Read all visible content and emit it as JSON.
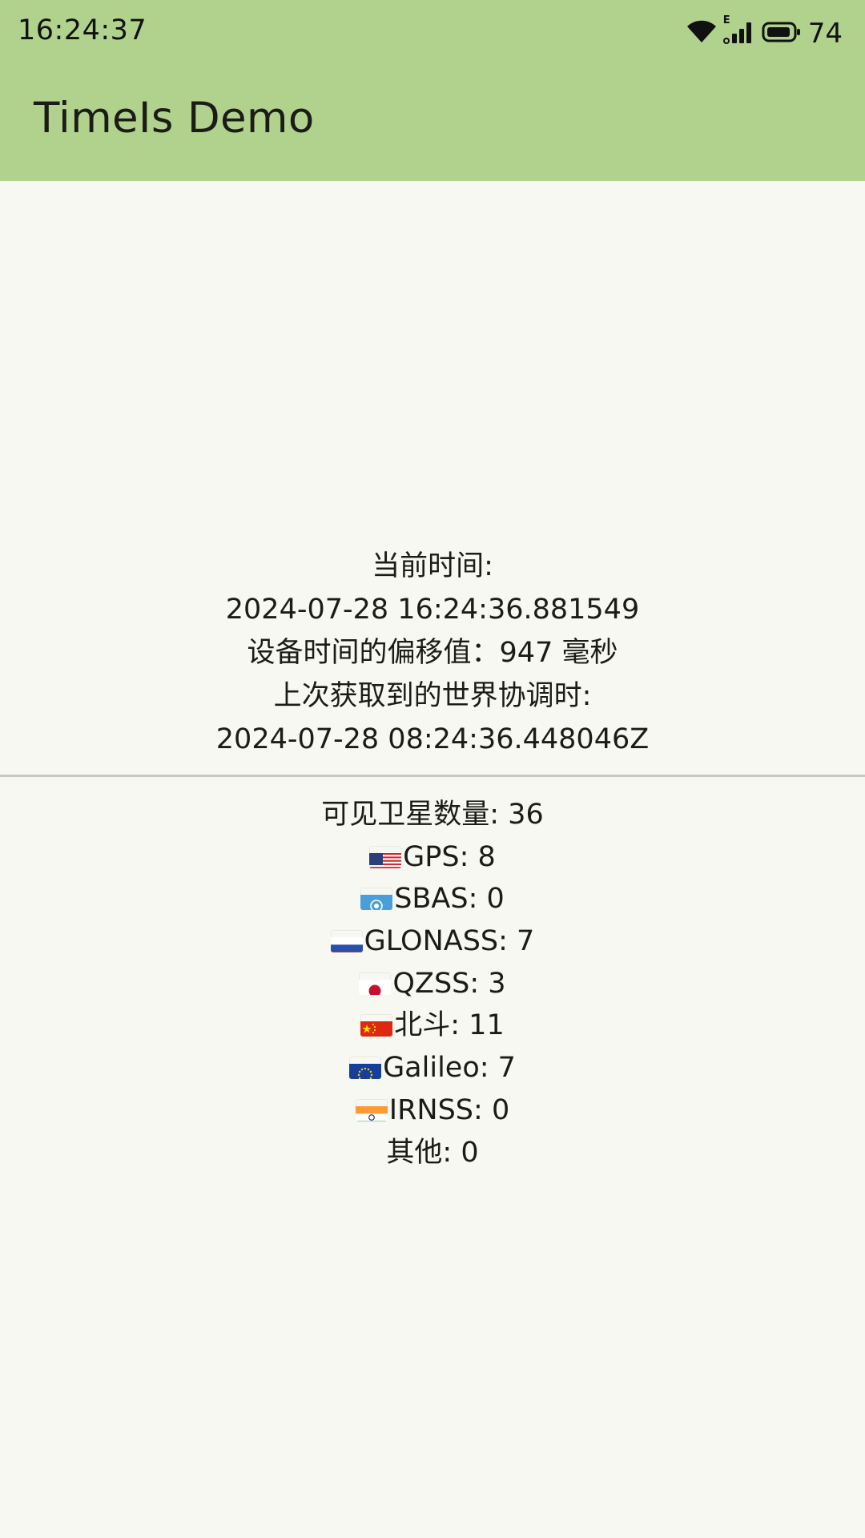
{
  "status_bar": {
    "time": "16:24:37",
    "network_type": "E",
    "battery": "74",
    "icons": [
      "wifi-icon",
      "signal-icon",
      "battery-icon"
    ]
  },
  "app_bar": {
    "title": "TimeIs Demo",
    "color": "#b1d28d"
  },
  "time_info": {
    "current_time_label": "当前时间:",
    "current_time_value": "2024-07-28 16:24:36.881549",
    "offset_line": "设备时间的偏移值：947 毫秒",
    "last_utc_label": "上次获取到的世界协调时:",
    "last_utc_value": "2024-07-28 08:24:36.448046Z"
  },
  "satellites": {
    "total_line": "可见卫星数量: 36",
    "systems": [
      {
        "flag": "us-flag-icon",
        "text": "GPS: 8"
      },
      {
        "flag": "un-flag-icon",
        "text": "SBAS: 0"
      },
      {
        "flag": "russia-flag-icon",
        "text": "GLONASS: 7"
      },
      {
        "flag": "japan-flag-icon",
        "text": "QZSS: 3"
      },
      {
        "flag": "china-flag-icon",
        "text": "北斗: 11"
      },
      {
        "flag": "eu-flag-icon",
        "text": "Galileo: 7"
      },
      {
        "flag": "india-flag-icon",
        "text": "IRNSS: 0"
      }
    ],
    "other_line": "其他: 0"
  }
}
